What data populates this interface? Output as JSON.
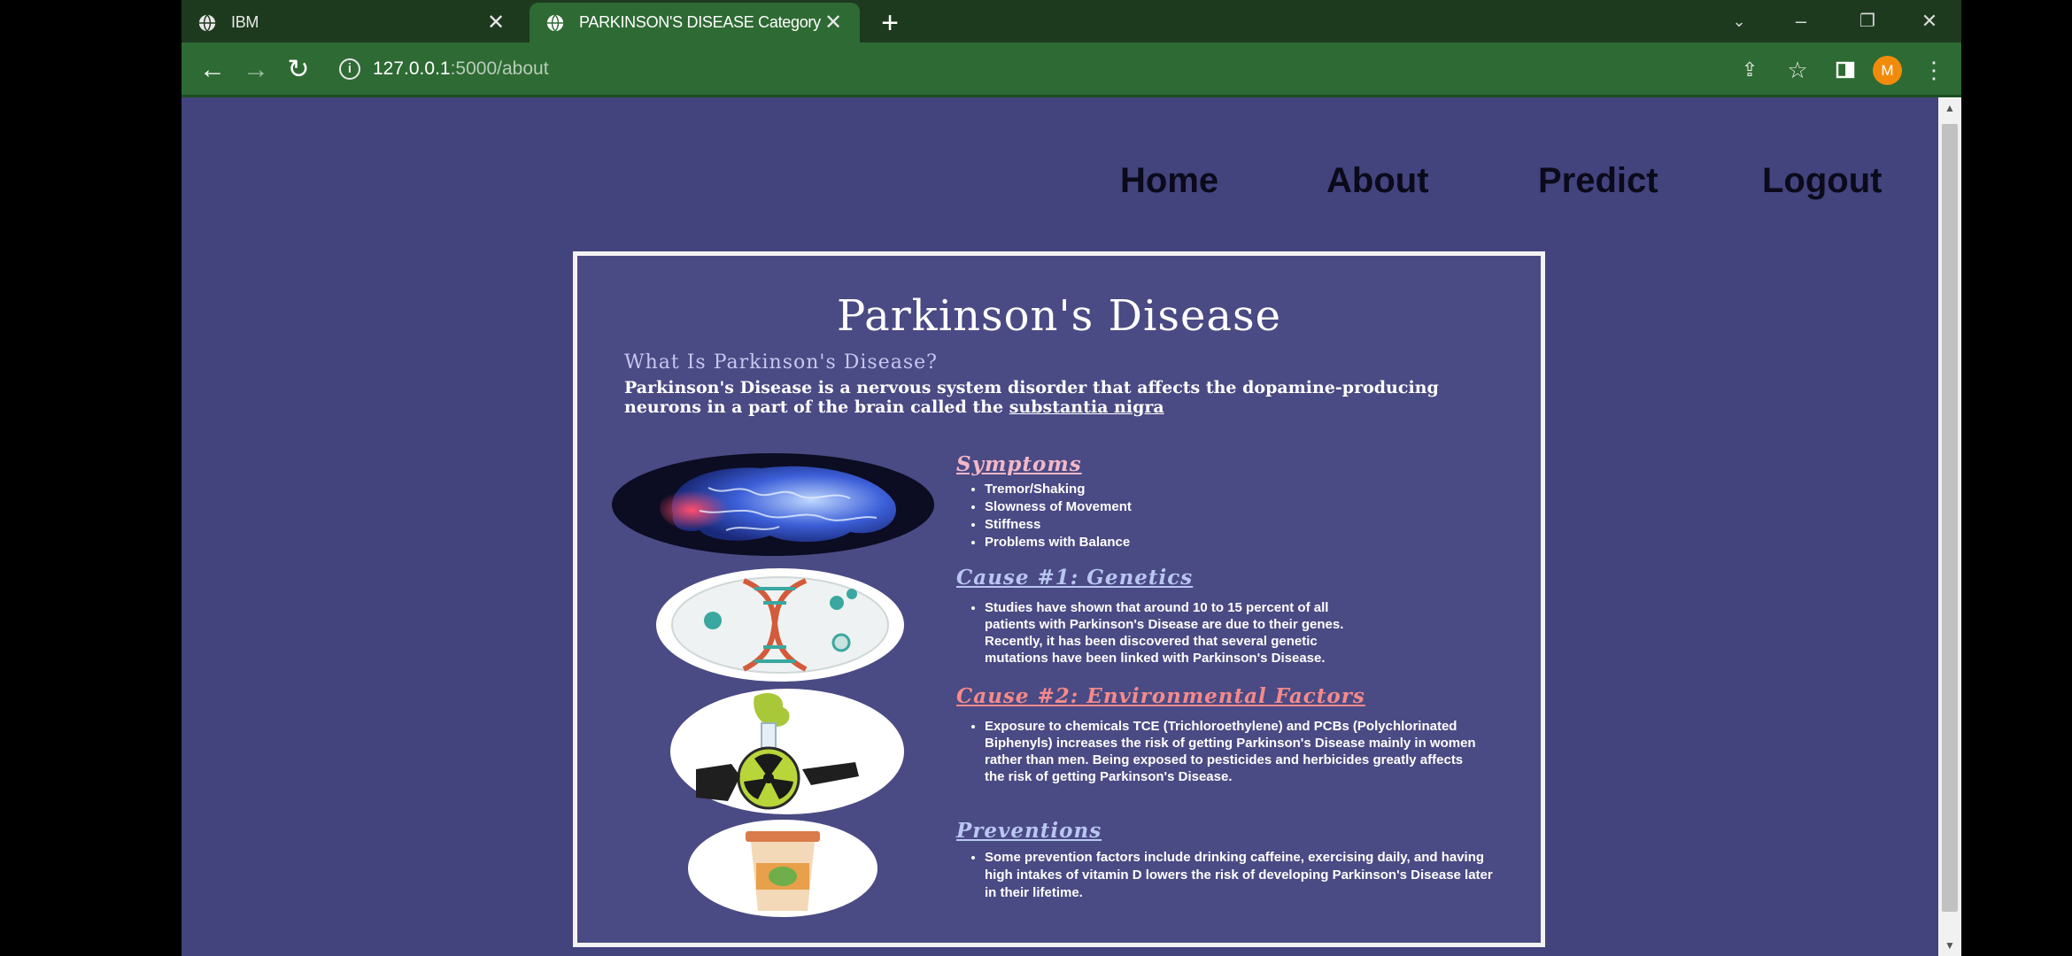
{
  "browser": {
    "tabs": [
      {
        "title": "IBM",
        "active": false
      },
      {
        "title": "PARKINSON'S DISEASE Category",
        "active": true
      }
    ],
    "url": {
      "host": "127.0.0.1",
      "path": ":5000/about"
    },
    "profile_initial": "M",
    "colors": {
      "frame": "#1d3a1f",
      "toolbar": "#2e6a33",
      "profile": "#f28b0c"
    }
  },
  "page": {
    "background": "#43437e",
    "nav": {
      "home": "Home",
      "about": "About",
      "predict": "Predict",
      "logout": "Logout"
    },
    "poster": {
      "title": "Parkinson's Disease",
      "intro_heading": "What Is Parkinson's Disease?",
      "intro_body": "Parkinson's Disease is a nervous system disorder that affects the dopamine-producing neurons in a part of the brain called the",
      "intro_link": "substantia nigra",
      "symptoms": {
        "title": "Symptoms",
        "items": [
          "Tremor/Shaking",
          "Slowness of Movement",
          "Stiffness",
          "Problems with Balance"
        ]
      },
      "cause1": {
        "title": "Cause #1: Genetics",
        "text": "Studies have shown that around 10 to 15 percent of all patients with Parkinson's Disease are due to their genes. Recently, it has been discovered that several genetic mutations have been linked with Parkinson's Disease."
      },
      "cause2": {
        "title": "Cause #2: Environmental Factors",
        "text": "Exposure to chemicals TCE (Trichloroethylene) and PCBs (Polychlorinated Biphenyls) increases the risk of getting Parkinson's Disease mainly in women rather than men. Being exposed to pesticides and herbicides greatly affects the risk of getting Parkinson's Disease."
      },
      "preventions": {
        "title": "Preventions",
        "text": "Some prevention factors include drinking caffeine, exercising daily, and having high intakes of vitamin D lowers the risk of developing Parkinson's Disease later in their lifetime."
      },
      "colors": {
        "symptoms": "#f2b8c8",
        "cause1": "#b9c6f2",
        "cause2": "#f58a8a",
        "preventions": "#b9c6f2"
      }
    }
  }
}
